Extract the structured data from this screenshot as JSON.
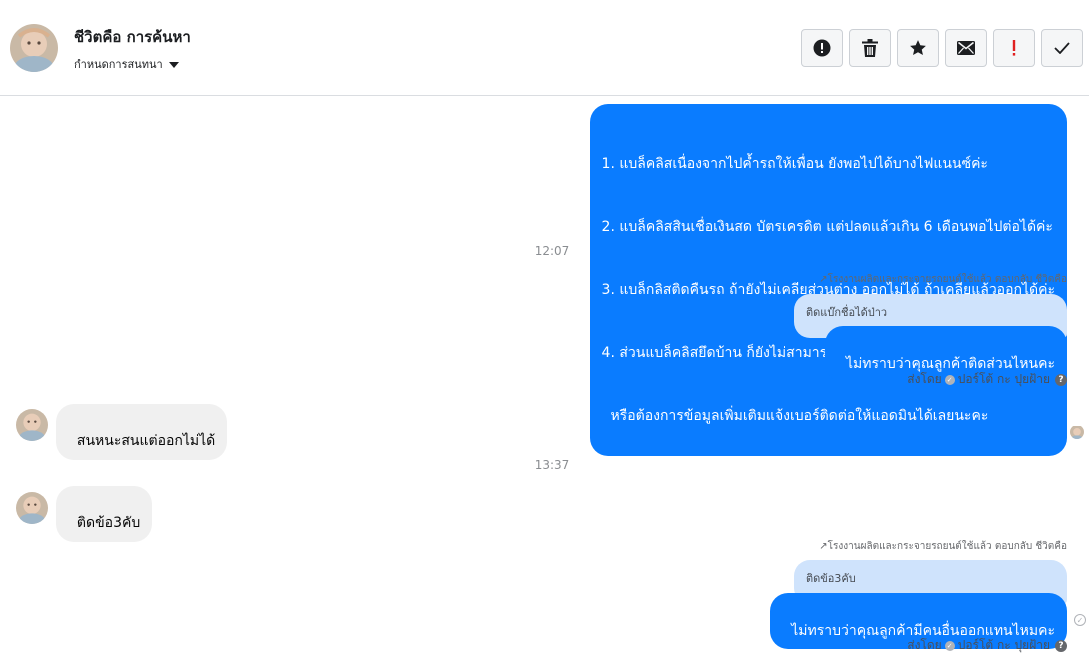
{
  "header": {
    "name": "ชีวิตคือ การค้นหา",
    "subtitle": "กำหนดการสนทนา",
    "actions": [
      {
        "icon": "alert-circle-icon",
        "label": "รายงาน"
      },
      {
        "icon": "trash-icon",
        "label": "ลบ"
      },
      {
        "icon": "star-icon",
        "label": "ติดดาว"
      },
      {
        "icon": "envelope-icon",
        "label": "ทำเครื่องหมายว่ายังไม่อ่าน"
      },
      {
        "icon": "exclamation-icon",
        "label": "ติดตาม"
      },
      {
        "icon": "check-icon",
        "label": "เสร็จสิ้น"
      }
    ]
  },
  "messages": {
    "m1": {
      "lines": [
        "1. แบล็คลิสเนื่องจากไปค้ำรถให้เพื่อน ยังพอไปได้บางไฟแนนซ์ค่ะ",
        "2. แบล็คลิสสินเชื่อเงินสด บัตรเครดิต แต่ปลดแล้วเกิน 6 เดือนพอไปต่อได้ค่ะ",
        "3. แบล็กลิสติดคืนรถ ถ้ายังไม่เคลียส่วนต่าง ออกไม่ได้ ถ้าเคลียแล้วออกได้ค่ะ",
        "4. ส่วนแบล็คลิสยึดบ้าน ก็ยังไม่สามารถออกได้ค่ะ",
        "  หรือต้องการข้อมูลเพิ่มเติมแจ้งเบอร์ติดต่อให้แอดมินได้เลยนะคะ"
      ]
    },
    "time1": "12:07",
    "reply1_meta": "โรงงานผลิตและกระจายรถยนต์ใช้แล้ว ตอบกลับ ชีวิตคือ",
    "reply1_quote": "ติดแบ๊กชื่อได้ป่าว",
    "reply1_text": "ไม่ทราบว่าคุณลูกค้าติดส่วนไหนคะ",
    "sent_by1": "ส่งโดย",
    "sender1": "ปอร์โต้ กะ ปุยฝ้าย",
    "m_in1": "สนหนะสนแต่ออกไม่ได้",
    "time2": "13:37",
    "m_in2": "ติดข้อ3คับ",
    "reply2_meta": "โรงงานผลิตและกระจายรถยนต์ใช้แล้ว ตอบกลับ ชีวิตคือ",
    "reply2_quote": "ติดข้อ3คับ",
    "reply2_text": "ไม่ทราบว่าคุณลูกค้ามีคนอื่นออกแทนไหมคะ",
    "sent_by2": "ส่งโดย",
    "sender2": "ปอร์โต้ กะ ปุยฝ้าย"
  },
  "colors": {
    "outgoing": "#0a7cff",
    "incoming": "#f0f0f0",
    "quote": "#cfe3fc",
    "divider": "#dadde1",
    "exclamation": "#e02020"
  }
}
